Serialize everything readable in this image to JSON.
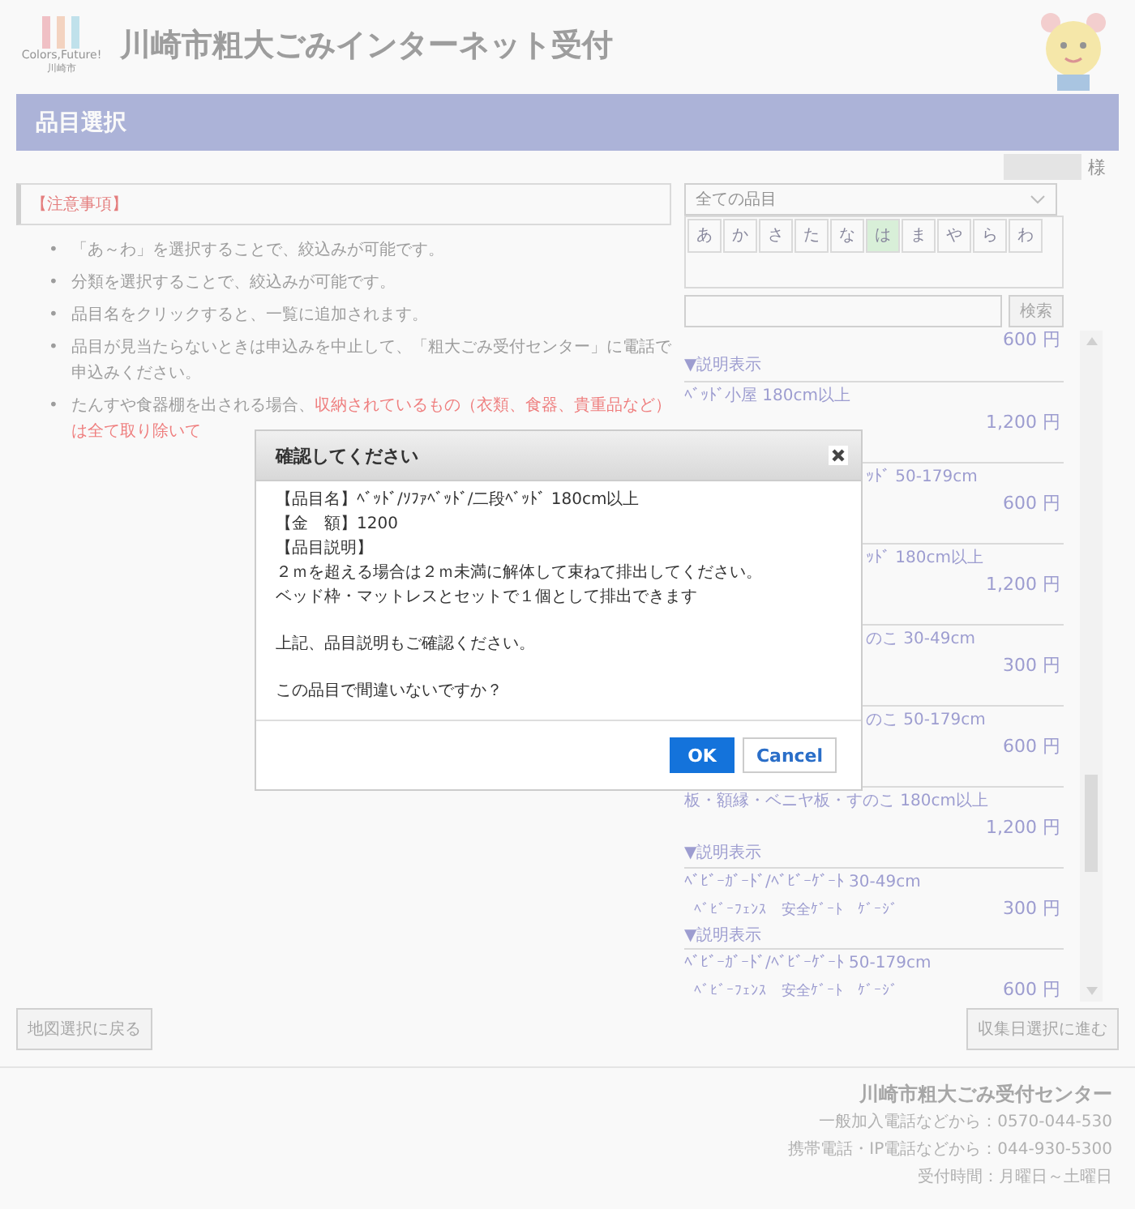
{
  "header": {
    "logo_text": "Colors,Future!",
    "logo_sub": "川崎市",
    "title": "川崎市粗大ごみインターネット受付"
  },
  "band": {
    "title": "品目選択"
  },
  "user": {
    "suffix": "様"
  },
  "notice": {
    "heading": "【注意事項】",
    "items": [
      {
        "bullet": "•",
        "text": "「あ～わ」を選択することで、絞込みが可能です。"
      },
      {
        "bullet": "•",
        "text": "分類を選択することで、絞込みが可能です。"
      },
      {
        "bullet": "•",
        "text": "品目名をクリックすると、一覧に追加されます。"
      },
      {
        "bullet": "•",
        "text": "品目が見当たらないときは申込みを中止して、「粗大ごみ受付センター」に電話で申込みください。"
      },
      {
        "bullet": "•",
        "text": "たんすや食器棚を出される場合、",
        "warning": "収納されているもの（衣類、食器、貴重品など）は全て取り除いて"
      }
    ]
  },
  "filter": {
    "category": "全ての品目",
    "kana": [
      {
        "label": "あ",
        "selected": false
      },
      {
        "label": "か",
        "selected": false
      },
      {
        "label": "さ",
        "selected": false
      },
      {
        "label": "た",
        "selected": false
      },
      {
        "label": "な",
        "selected": false
      },
      {
        "label": "は",
        "selected": true
      },
      {
        "label": "ま",
        "selected": false
      },
      {
        "label": "や",
        "selected": false
      },
      {
        "label": "ら",
        "selected": false
      },
      {
        "label": "わ",
        "selected": false
      }
    ],
    "search_button": "検索"
  },
  "items": [
    {
      "kind": "top",
      "price": "600 円",
      "desc_link": "▼説明表示"
    },
    {
      "kind": "full",
      "name": "ﾍﾞｯﾄﾞ小屋 180cm以上",
      "price": "1,200 円"
    },
    {
      "kind": "partial",
      "name": "ｯﾄﾞ 50-179cm",
      "price": "600 円"
    },
    {
      "kind": "partial",
      "name": "ｯﾄﾞ 180cm以上",
      "price": "1,200 円"
    },
    {
      "kind": "partial",
      "name": "のこ 30-49cm",
      "price": "300 円"
    },
    {
      "kind": "partial",
      "name": "のこ 50-179cm",
      "price": "600 円"
    },
    {
      "kind": "full",
      "name": "板・額縁・ベニヤ板・すのこ 180cm以上",
      "price": "1,200 円",
      "desc_link": "▼説明表示"
    },
    {
      "kind": "full",
      "name": "ﾍﾞﾋﾞｰｶﾞｰﾄﾞ/ﾍﾞﾋﾞｰｹﾞｰﾄ 30-49cm",
      "sub": "ﾍﾞﾋﾞｰﾌｪﾝｽ　安全ｹﾞｰﾄ　ｹﾞｰｼﾞ",
      "price": "300 円",
      "desc_link": "▼説明表示"
    },
    {
      "kind": "full",
      "name": "ﾍﾞﾋﾞｰｶﾞｰﾄﾞ/ﾍﾞﾋﾞｰｹﾞｰﾄ 50-179cm",
      "sub": "ﾍﾞﾋﾞｰﾌｪﾝｽ　安全ｹﾞｰﾄ　ｹﾞｰｼﾞ",
      "price": "600 円"
    }
  ],
  "nav": {
    "back": "地図選択に戻る",
    "next": "収集日選択に進む"
  },
  "footer": [
    "川崎市粗大ごみ受付センター",
    "一般加入電話などから：0570-044-530",
    "携帯電話・IP電話などから：044-930-5300",
    "受付時間：月曜日～土曜日"
  ],
  "dialog": {
    "title": "確認してください",
    "paragraphs": [
      [
        "【品目名】ﾍﾞｯﾄﾞ/ｿﾌｧﾍﾞｯﾄﾞ/二段ﾍﾞｯﾄﾞ 180cm以上",
        "【金　額】1200",
        "【品目説明】",
        "２ｍを超える場合は２ｍ未満に解体して束ねて排出してください。",
        "ベッド枠・マットレスとセットで１個として排出できます"
      ],
      [
        "上記、品目説明もご確認ください。"
      ],
      [
        "この品目で間違いないですか？"
      ]
    ],
    "ok": "OK",
    "cancel": "Cancel"
  }
}
